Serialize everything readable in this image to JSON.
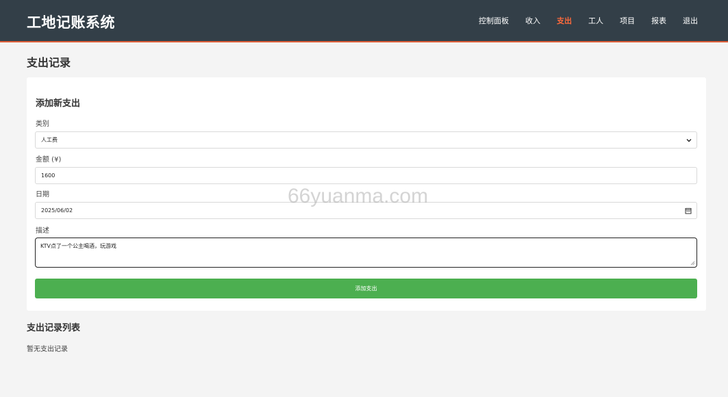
{
  "app": {
    "brand": "工地记账系统"
  },
  "nav": {
    "items": [
      {
        "label": "控制面板",
        "active": false
      },
      {
        "label": "收入",
        "active": false
      },
      {
        "label": "支出",
        "active": true
      },
      {
        "label": "工人",
        "active": false
      },
      {
        "label": "项目",
        "active": false
      },
      {
        "label": "报表",
        "active": false
      },
      {
        "label": "退出",
        "active": false
      }
    ],
    "active_color": "#ff6a3c"
  },
  "page": {
    "title": "支出记录"
  },
  "form": {
    "title": "添加新支出",
    "category": {
      "label": "类别",
      "value": "人工费"
    },
    "amount": {
      "label": "金额 (¥)",
      "value": "1600"
    },
    "date": {
      "label": "日期",
      "value": "2025/06/02"
    },
    "description": {
      "label": "描述",
      "value": "KTV点了一个公主喝酒，玩游戏"
    },
    "submit_label": "添加支出",
    "submit_color": "#4caf50"
  },
  "list": {
    "title": "支出记录列表",
    "empty_text": "暂无支出记录"
  },
  "watermark": "66yuanma.com",
  "colors": {
    "header_bg": "#333f48",
    "header_border": "#e2603a"
  }
}
